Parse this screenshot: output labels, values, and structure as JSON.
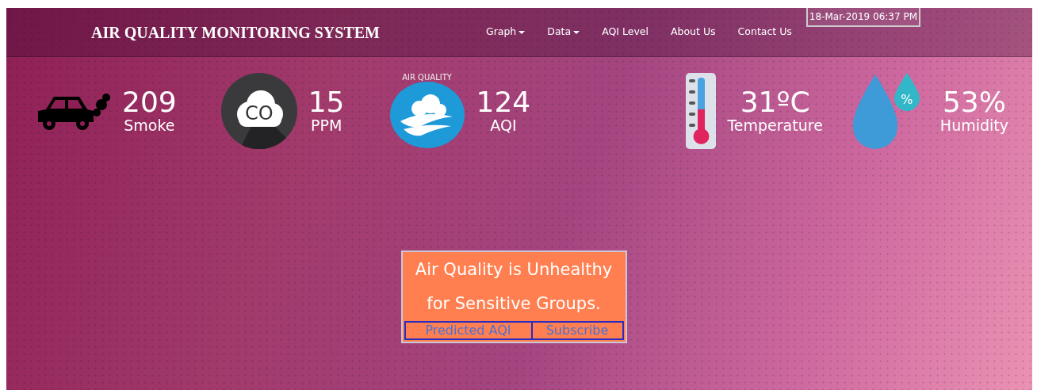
{
  "header": {
    "title": "AIR QUALITY MONITORING SYSTEM",
    "nav": [
      {
        "label": "Graph",
        "dropdown": true
      },
      {
        "label": "Data",
        "dropdown": true
      },
      {
        "label": "AQI Level",
        "dropdown": false
      },
      {
        "label": "About Us",
        "dropdown": false
      },
      {
        "label": "Contact Us",
        "dropdown": false
      }
    ],
    "datetime": "18-Mar-2019 06:37 PM"
  },
  "metrics": [
    {
      "kind": "smoke",
      "value": "209",
      "label": "Smoke"
    },
    {
      "kind": "co",
      "value": "15",
      "label": "PPM",
      "icon_text": "CO"
    },
    {
      "kind": "aqi",
      "value": "124",
      "label": "AQI",
      "icon_caption": "AIR QUALITY"
    },
    {
      "kind": "temperature",
      "value": "31ºC",
      "label": "Temperature"
    },
    {
      "kind": "humidity",
      "value": "53%",
      "label": "Humidity",
      "icon_text": "%"
    }
  ],
  "status": {
    "message": "Air Quality is Unhealthy for Sensitive Groups.",
    "color": "#ff7f50",
    "buttons": [
      "Predicted AQI",
      "Subscribe"
    ]
  }
}
